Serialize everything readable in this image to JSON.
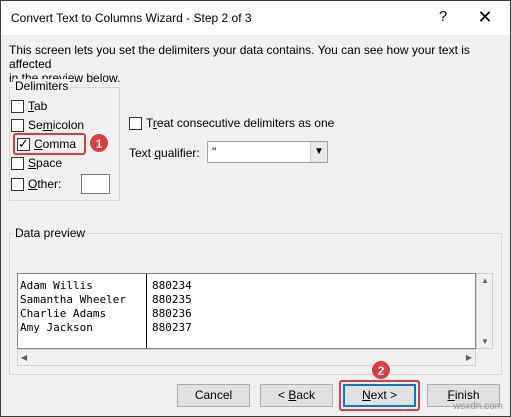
{
  "window": {
    "title": "Convert Text to Columns Wizard - Step 2 of 3",
    "help_glyph": "?",
    "close_glyph": "✕"
  },
  "intro": {
    "line1": "This screen lets you set the delimiters your data contains.  You can see how your text is affected",
    "line2": "in the preview below."
  },
  "delimiters": {
    "label": "Delimiters",
    "items": [
      {
        "pre": "",
        "u": "T",
        "post": "ab",
        "checked": false
      },
      {
        "pre": "Se",
        "u": "m",
        "post": "icolon",
        "checked": false
      },
      {
        "pre": "",
        "u": "C",
        "post": "omma",
        "checked": true
      },
      {
        "pre": "",
        "u": "S",
        "post": "pace",
        "checked": false
      },
      {
        "pre": "",
        "u": "O",
        "post": "ther:",
        "checked": false
      }
    ],
    "other_value": ""
  },
  "consecutive": {
    "pre": "T",
    "u": "r",
    "post": "eat consecutive delimiters as one",
    "checked": false
  },
  "qualifier": {
    "pre": "Text ",
    "u": "q",
    "post": "ualifier:",
    "value": "\""
  },
  "preview": {
    "label": "Data preview",
    "rows": [
      [
        "Adam Willis",
        "880234"
      ],
      [
        "Samantha Wheeler",
        "880235"
      ],
      [
        "Charlie Adams",
        "880236"
      ],
      [
        "Amy Jackson",
        "880237"
      ]
    ]
  },
  "buttons": {
    "cancel": "Cancel",
    "back_pre": "< ",
    "back_u": "B",
    "back_post": "ack",
    "next_u": "N",
    "next_post": "ext >",
    "finish_u": "F",
    "finish_post": "inish"
  },
  "annotations": {
    "step1": "1",
    "step2": "2",
    "accent": "#e03c3c"
  },
  "watermark": "wsxdn.com"
}
